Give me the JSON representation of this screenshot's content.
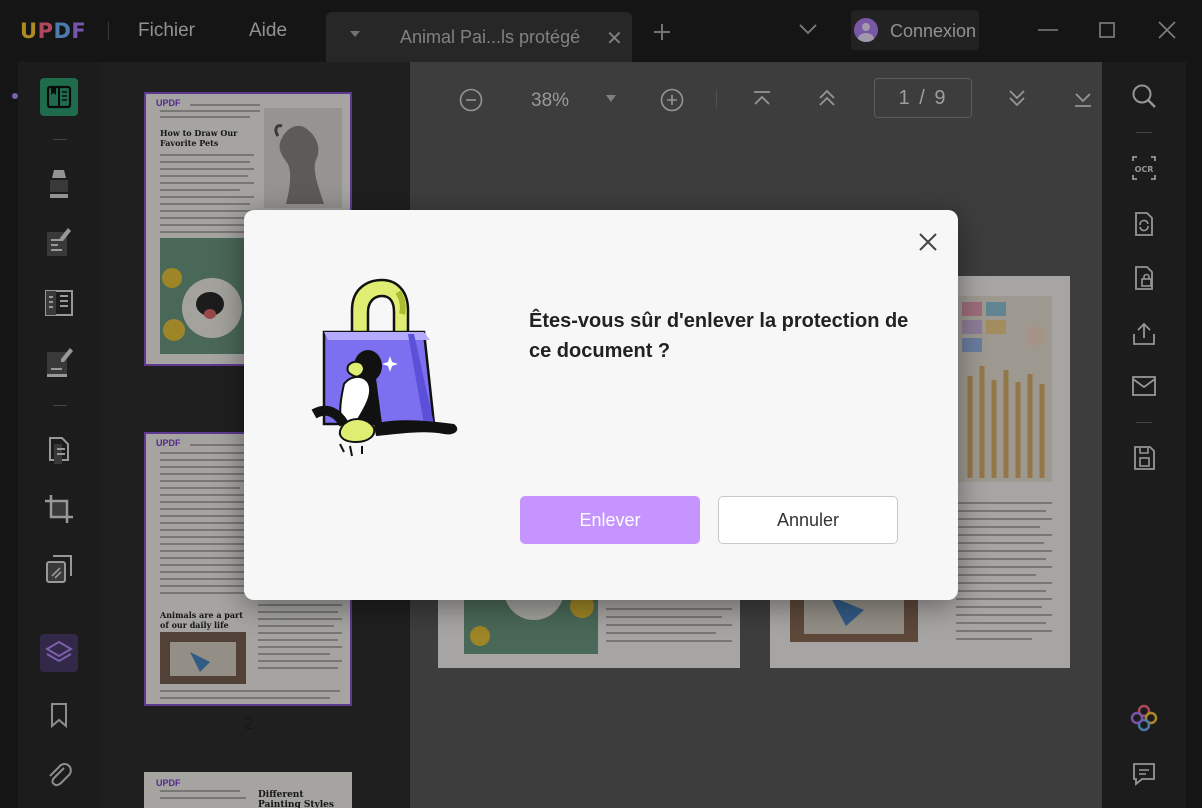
{
  "app": {
    "logo": "UPDF",
    "menu": [
      "Fichier",
      "Aide"
    ],
    "tab_title": "Animal Pai...ls protégé",
    "login_label": "Connexion"
  },
  "colors": {
    "accent": "#c594ff",
    "brand_purple": "#8a55d8",
    "toolbar_bg": "#2a2a2a"
  },
  "viewer": {
    "zoom": "38%",
    "page_indicator": "1 / 9"
  },
  "thumbnails": {
    "page1_heading": "How to Draw Our Favorite Pets",
    "page2_heading": "Animals are a part of our daily life",
    "page3_heading": "Different Painting Styles",
    "page_number_label": "2",
    "logo_small": "UPDF"
  },
  "dialog": {
    "message": "Êtes-vous sûr d'enlever la protection de ce document ?",
    "confirm_label": "Enlever",
    "cancel_label": "Annuler"
  },
  "icons": {
    "left": [
      "reader-icon",
      "highlighter-icon",
      "edit-text-icon",
      "form-icon",
      "sign-icon",
      "organize-pages-icon",
      "crop-icon",
      "convert-icon",
      "layers-icon",
      "bookmark-icon",
      "attachment-icon"
    ],
    "right": [
      "search-icon",
      "ocr-icon",
      "convert-pdf-icon",
      "protect-icon",
      "share-icon",
      "email-icon",
      "save-icon",
      "ai-assistant-icon",
      "comment-icon"
    ]
  }
}
